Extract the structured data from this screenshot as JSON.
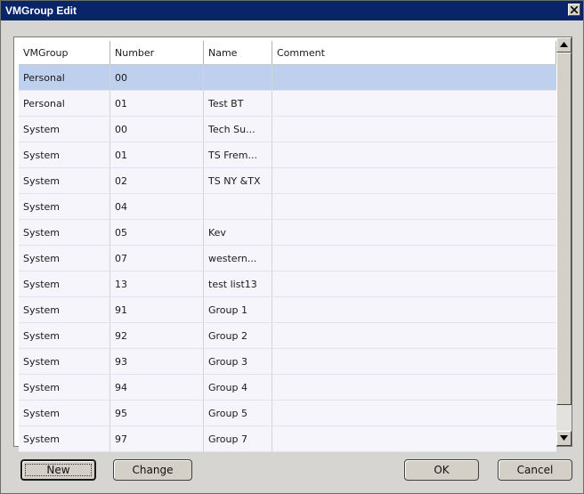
{
  "window": {
    "title": "VMGroup Edit"
  },
  "table": {
    "columns": [
      "VMGroup",
      "Number",
      "Name",
      "Comment"
    ],
    "rows": [
      {
        "vmgroup": "Personal",
        "number": "00",
        "name": "",
        "comment": "",
        "selected": true
      },
      {
        "vmgroup": "Personal",
        "number": "01",
        "name": "Test BT",
        "comment": ""
      },
      {
        "vmgroup": "System",
        "number": "00",
        "name": "Tech Su...",
        "comment": ""
      },
      {
        "vmgroup": "System",
        "number": "01",
        "name": "TS Frem...",
        "comment": ""
      },
      {
        "vmgroup": "System",
        "number": "02",
        "name": "TS NY &TX",
        "comment": ""
      },
      {
        "vmgroup": "System",
        "number": "04",
        "name": "",
        "comment": ""
      },
      {
        "vmgroup": "System",
        "number": "05",
        "name": "Kev",
        "comment": ""
      },
      {
        "vmgroup": "System",
        "number": "07",
        "name": "western...",
        "comment": ""
      },
      {
        "vmgroup": "System",
        "number": "13",
        "name": "test list13",
        "comment": ""
      },
      {
        "vmgroup": "System",
        "number": "91",
        "name": "Group 1",
        "comment": ""
      },
      {
        "vmgroup": "System",
        "number": "92",
        "name": "Group 2",
        "comment": ""
      },
      {
        "vmgroup": "System",
        "number": "93",
        "name": "Group 3",
        "comment": ""
      },
      {
        "vmgroup": "System",
        "number": "94",
        "name": "Group 4",
        "comment": ""
      },
      {
        "vmgroup": "System",
        "number": "95",
        "name": "Group 5",
        "comment": ""
      },
      {
        "vmgroup": "System",
        "number": "97",
        "name": "Group 7",
        "comment": ""
      }
    ]
  },
  "buttons": {
    "new": "New",
    "change": "Change",
    "ok": "OK",
    "cancel": "Cancel"
  },
  "colors": {
    "titlebar": "#0a246a",
    "selected_row": "#bfcfee",
    "row": "#f6f5fb"
  }
}
